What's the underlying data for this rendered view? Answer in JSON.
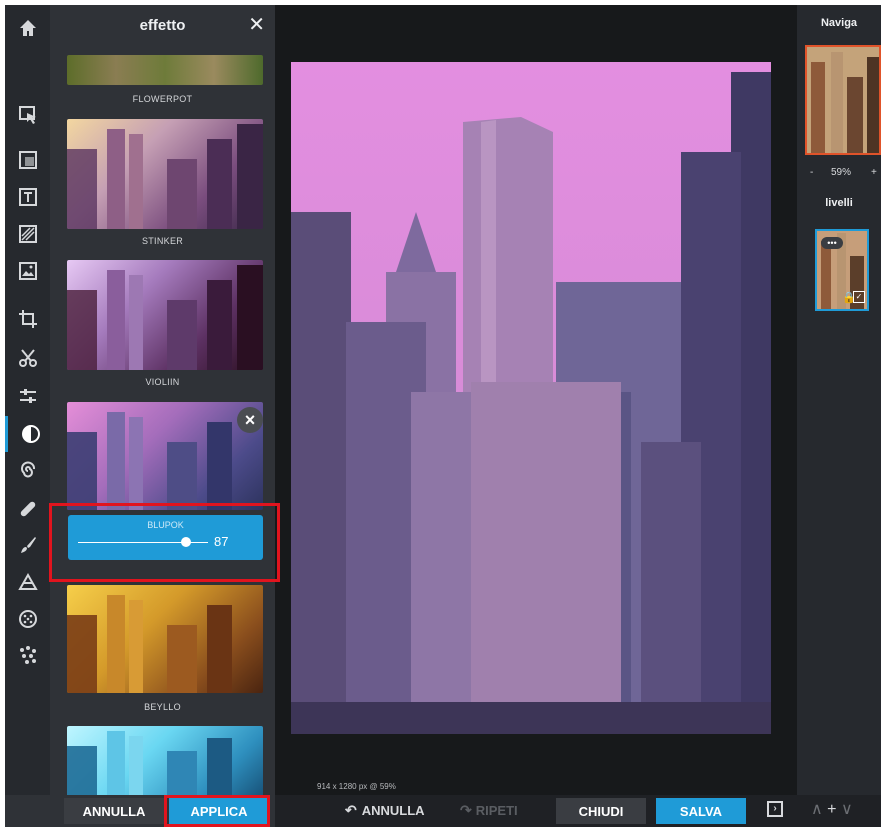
{
  "panel": {
    "title": "effetto",
    "close": "✕"
  },
  "effects": [
    {
      "label": "FLOWERPOT"
    },
    {
      "label": "STINKER"
    },
    {
      "label": "VIOLIIN"
    },
    {
      "label": "BLUPOK"
    },
    {
      "label": "BEYLLO"
    },
    {
      "label": ""
    }
  ],
  "slider": {
    "name": "BLUPOK",
    "value": "87",
    "level": 0.87
  },
  "panel_buttons": {
    "cancel": "ANNULLA",
    "apply": "APPLICA"
  },
  "canvas": {
    "size_info": "914 x 1280 px @ 59%"
  },
  "bottom_bar": {
    "undo": "ANNULLA",
    "redo": "RIPETI",
    "close": "CHIUDI",
    "save": "SALVA"
  },
  "right_panel": {
    "navigator_title": "Naviga",
    "zoom_minus": "-",
    "zoom_value": "59%",
    "zoom_plus": "+",
    "layers_title": "livelli"
  },
  "colors": {
    "accent": "#1f9bd7",
    "highlight": "#e1141e",
    "panel": "#2f3237"
  },
  "tools": [
    "home-icon",
    "cursor-icon",
    "layout-icon",
    "text-icon",
    "texture-icon",
    "image-icon",
    "crop-icon",
    "cut-icon",
    "adjust-icon",
    "effect-icon",
    "swirl-icon",
    "bandage-icon",
    "brush-icon",
    "draw-icon",
    "pattern-icon",
    "particles-icon",
    "settings-icon"
  ]
}
